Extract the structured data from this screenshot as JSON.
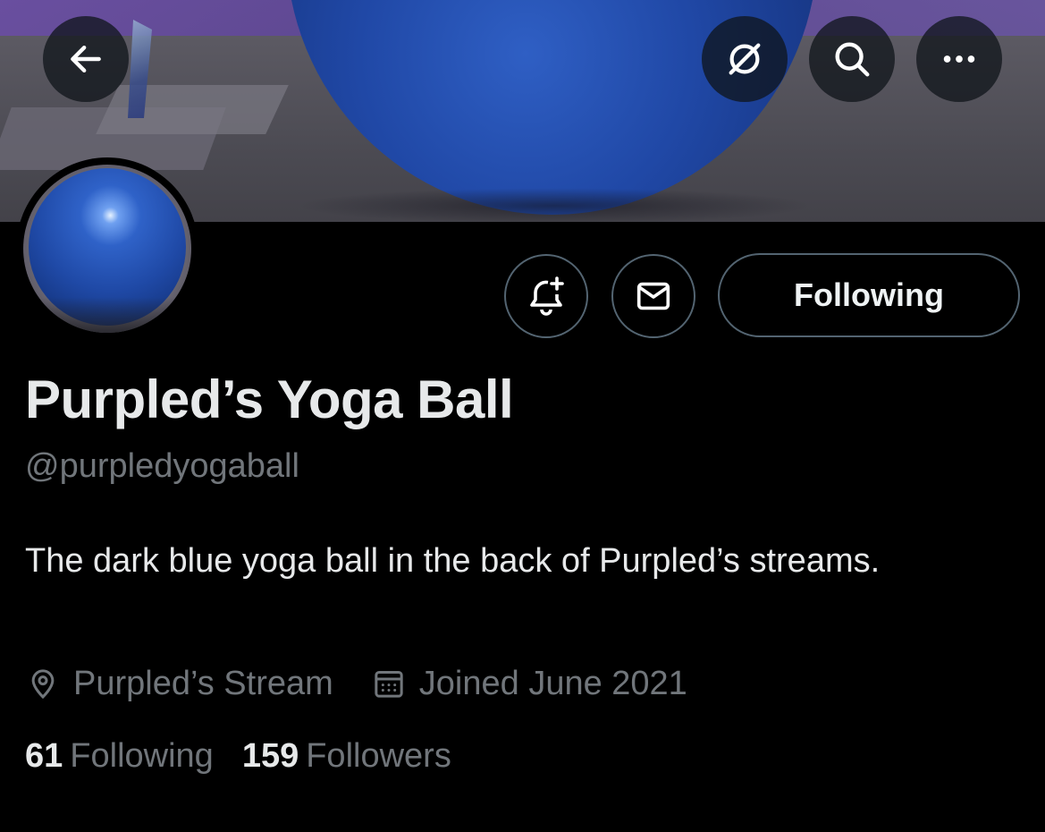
{
  "header": {
    "back_icon": "arrow-left-icon",
    "grok_icon": "slashed-circle-icon",
    "search_icon": "search-icon",
    "more_icon": "more-horizontal-icon"
  },
  "actions": {
    "notify_icon": "bell-plus-icon",
    "message_icon": "envelope-icon",
    "follow_label": "Following"
  },
  "profile": {
    "display_name": "Purpled’s Yoga Ball",
    "handle": "@purpledyogaball",
    "bio": "The dark blue yoga ball in the back of Purpled’s streams.",
    "location": "Purpled’s Stream",
    "joined": "Joined June 2021"
  },
  "stats": {
    "following_count": "61",
    "following_label": "Following",
    "followers_count": "159",
    "followers_label": "Followers"
  },
  "colors": {
    "background": "#000000",
    "primary_text": "#e7e9ea",
    "secondary_text": "#71767b",
    "border": "#536471"
  }
}
